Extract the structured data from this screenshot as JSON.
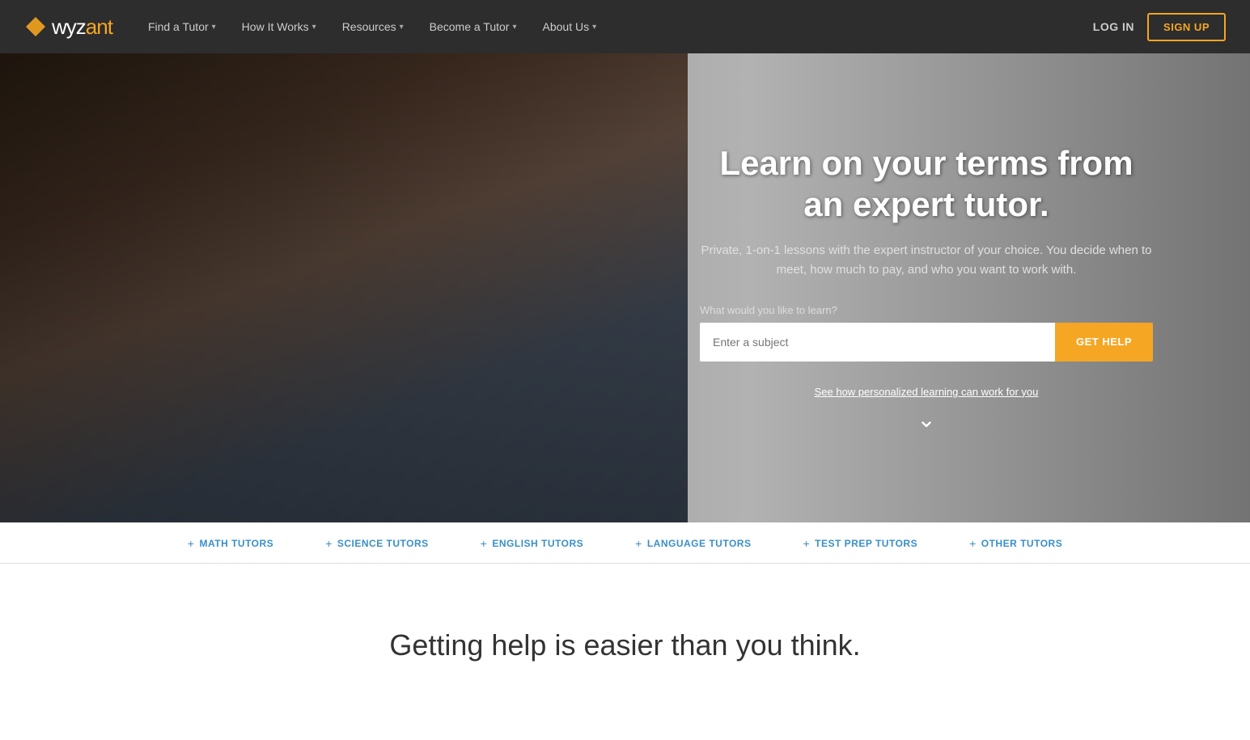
{
  "navbar": {
    "logo": {
      "wyz": "wyz",
      "ant": "ant"
    },
    "nav_items": [
      {
        "label": "Find a Tutor",
        "has_arrow": true
      },
      {
        "label": "How It Works",
        "has_arrow": true
      },
      {
        "label": "Resources",
        "has_arrow": true
      },
      {
        "label": "Become a Tutor",
        "has_arrow": true
      },
      {
        "label": "About Us",
        "has_arrow": true
      }
    ],
    "login_label": "LOG IN",
    "signup_label": "SIGN UP"
  },
  "hero": {
    "title": "Learn on your terms from an expert tutor.",
    "subtitle": "Private, 1-on-1 lessons with the expert instructor of your choice.\nYou decide when to meet, how much to pay, and who you want to work with.",
    "search_label": "What would you like to learn?",
    "search_placeholder": "Enter a subject",
    "get_help_label": "GET HELP",
    "see_how_label": "See how personalized learning can work for you",
    "chevron": "⌄"
  },
  "tutor_bar": {
    "items": [
      {
        "label": "MATH TUTORS"
      },
      {
        "label": "SCIENCE TUTORS"
      },
      {
        "label": "ENGLISH TUTORS"
      },
      {
        "label": "LANGUAGE TUTORS"
      },
      {
        "label": "TEST PREP TUTORS"
      },
      {
        "label": "OTHER TUTORS"
      }
    ],
    "plus_symbol": "+"
  },
  "bottom": {
    "title": "Getting help is easier than you think."
  }
}
